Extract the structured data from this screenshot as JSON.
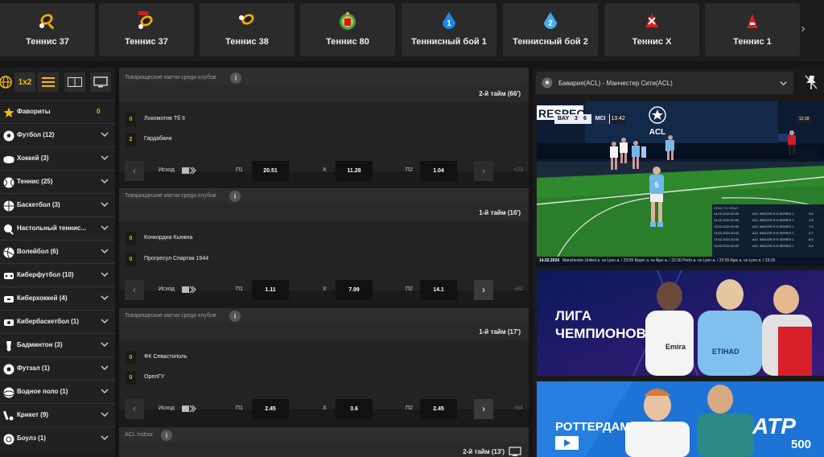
{
  "games": [
    {
      "label": "Теннис 37",
      "icon": "tennis-racket-icon"
    },
    {
      "label": "Теннис 37",
      "icon": "tennis-racket-new-icon",
      "badge": "NEW"
    },
    {
      "label": "Теннис 38",
      "icon": "tennis-racket-icon"
    },
    {
      "label": "Теннис 80",
      "icon": "tennis-badge-icon"
    },
    {
      "label": "Теннисный бой 1",
      "icon": "blue-drop-1-icon"
    },
    {
      "label": "Теннисный бой 2",
      "icon": "blue-drop-2-icon"
    },
    {
      "label": "Теннис X",
      "icon": "red-x-icon"
    },
    {
      "label": "Теннис 1",
      "icon": "red-tennis-icon"
    }
  ],
  "sport_tabs": [
    "globe-icon",
    "1x2",
    "list-icon",
    "scoreboard-icon",
    "tv-icon"
  ],
  "sports": [
    {
      "label": "Фавориты",
      "count": "0",
      "icon": "star-icon"
    },
    {
      "label": "Футбол (12)",
      "icon": "football-icon"
    },
    {
      "label": "Хоккей (3)",
      "icon": "hockey-puck-icon"
    },
    {
      "label": "Теннис (25)",
      "icon": "tennis-ball-icon"
    },
    {
      "label": "Баскетбол (3)",
      "icon": "basketball-icon"
    },
    {
      "label": "Настольный теннис...",
      "icon": "table-tennis-icon"
    },
    {
      "label": "Волейбол (6)",
      "icon": "volleyball-icon"
    },
    {
      "label": "Киберфутбол (10)",
      "icon": "cyber-football-icon"
    },
    {
      "label": "Киберхоккей (4)",
      "icon": "cyber-hockey-icon"
    },
    {
      "label": "Кибербаскетбол (1)",
      "icon": "cyber-basketball-icon"
    },
    {
      "label": "Бадминтон (3)",
      "icon": "shuttlecock-icon"
    },
    {
      "label": "Футзал (1)",
      "icon": "futsal-icon"
    },
    {
      "label": "Водное поло (1)",
      "icon": "water-polo-icon"
    },
    {
      "label": "Крикет (9)",
      "icon": "cricket-icon"
    },
    {
      "label": "Боулз (1)",
      "icon": "bowls-icon"
    }
  ],
  "matches": [
    {
      "league": "Товарищеские матчи среди клубов",
      "period": "2-й тайм  (66')",
      "team1": "Локомотив Тб II",
      "score1": "0",
      "team2": "Гардабани",
      "score2": "2",
      "market": "Исход",
      "p1_label": "П1",
      "p1": "20.51",
      "x_label": "X",
      "x": "11.28",
      "p2_label": "П2",
      "p2": "1.04",
      "more": "+23"
    },
    {
      "league": "Товарищеские матчи среди клубов",
      "period": "1-й тайм  (16')",
      "team1": "Конкордиа Кьяжна",
      "score1": "0",
      "team2": "Прогресул Спартак 1944",
      "score2": "0",
      "market": "Исход",
      "p1_label": "П1",
      "p1": "1.11",
      "x_label": "X",
      "x": "7.99",
      "p2_label": "П2",
      "p2": "14.1",
      "more": "+82"
    },
    {
      "league": "Товарищеские матчи среди клубов",
      "period": "1-й тайм  (17')",
      "team1": "ФК Севастополь",
      "score1": "0",
      "team2": "ОрелГУ",
      "score2": "0",
      "market": "Исход",
      "p1_label": "П1",
      "p1": "2.45",
      "x_label": "X",
      "x": "3.6",
      "p2_label": "П2",
      "p2": "2.45",
      "more": "+84"
    },
    {
      "league": "ACL Indoor",
      "period": "2-й тайм  (13')"
    }
  ],
  "right": {
    "selected_match": "Бавария(ACL) - Манчестер Сити(ACL)",
    "video": {
      "brand": "RESPECT",
      "home": "BAY",
      "home_score": "3",
      "away_score": "6",
      "away": "MCI",
      "clock": "13:42",
      "league_logo": "ACL",
      "ticker": "Manchester United a. vs Lyon a. / 23:05 Bayer a. vs Ajax a. / 22:30 Porto a. vs Lyon a. / 22:55 Ajax a. vs Lyon a. / 23:25",
      "h2h_title": "HEAD TO HEAD",
      "h2h": [
        {
          "date": "14.02.2024 00:00",
          "name": "ACL INDOOR 5+5 SERIES 1",
          "res": "4:6"
        },
        {
          "date": "14.02.2024 00:00",
          "name": "ACL INDOOR 5+5 SERIES 1",
          "res": "1:8"
        },
        {
          "date": "13.02.2024 00:00",
          "name": "ACL INDOOR 5+5 SERIES 1",
          "res": "7:3"
        },
        {
          "date": "13.02.2024 00:00",
          "name": "ACL INDOOR 5+5 SERIES 1",
          "res": "4:7"
        },
        {
          "date": "13.02.2024 00:00",
          "name": "ACL INDOOR 5+5 SERIES 1",
          "res": "6:5"
        },
        {
          "date": "13.02.2024 00:00",
          "name": "ACL INDOOR 5+5 SERIES 1",
          "res": "3:4"
        }
      ],
      "date_stamp": "14.02.2024",
      "time_badge": "12:18",
      "player_number": "5"
    },
    "banner1": {
      "line1": "ЛИГА",
      "line2": "ЧЕМПИОНОВ",
      "jersey_text": "Emira",
      "jersey_text2": "ETIHAD"
    },
    "banner2": {
      "title": "РОТТЕРДАМ",
      "brand": "ATP",
      "brand_sub": "500"
    }
  },
  "colors": {
    "accent": "#f2b90d",
    "bg": "#141414"
  }
}
